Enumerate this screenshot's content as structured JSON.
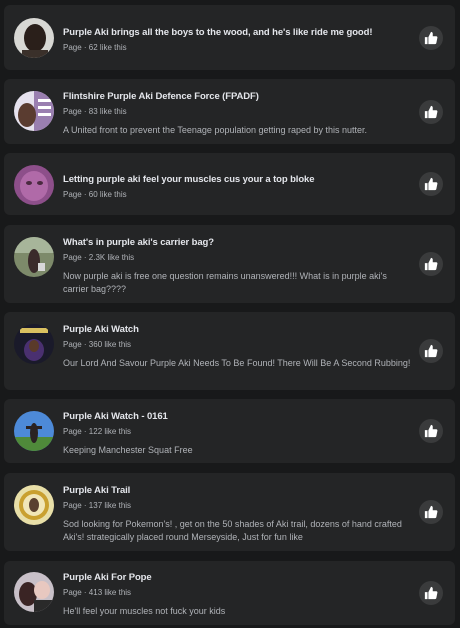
{
  "pages": [
    {
      "title": "Purple Aki brings all the boys to the wood, and he's like ride me good!",
      "meta": "Page · 62 like this",
      "description": ""
    },
    {
      "title": "Flintshire Purple Aki Defence Force (FPADF)",
      "meta": "Page · 83 like this",
      "description": "A United front to prevent the Teenage population getting raped by this nutter."
    },
    {
      "title": "Letting purple aki feel your muscles cus your a top bloke",
      "meta": "Page · 60 like this",
      "description": ""
    },
    {
      "title": "What's in purple aki's carrier bag?",
      "meta": "Page · 2.3K like this",
      "description": "Now purple aki is free one question remains unanswered!!! What is in purple aki's carrier bag????"
    },
    {
      "title": "Purple Aki Watch",
      "meta": "Page · 360 like this",
      "description": "Our Lord And Savour Purple Aki Needs To Be Found! There Will Be A Second Rubbing!"
    },
    {
      "title": "Purple Aki Watch - 0161",
      "meta": "Page · 122 like this",
      "description": "Keeping Manchester Squat Free"
    },
    {
      "title": "Purple Aki Trail",
      "meta": "Page · 137 like this",
      "description": "Sod looking for Pokemon's! , get on the 50 shades of Aki trail, dozens of hand crafted Aki's! strategically placed round Merseyside, Just for fun like"
    },
    {
      "title": "Purple Aki For Pope",
      "meta": "Page · 413 like this",
      "description": "He'll feel your muscles not fuck your kids"
    }
  ],
  "icons": {
    "like_button": "thumbs-up-icon"
  },
  "colors": {
    "background": "#18191a",
    "card": "#242526",
    "title_text": "#e4e6eb",
    "secondary_text": "#b0b3b8",
    "button_bg": "#3a3b3c"
  }
}
